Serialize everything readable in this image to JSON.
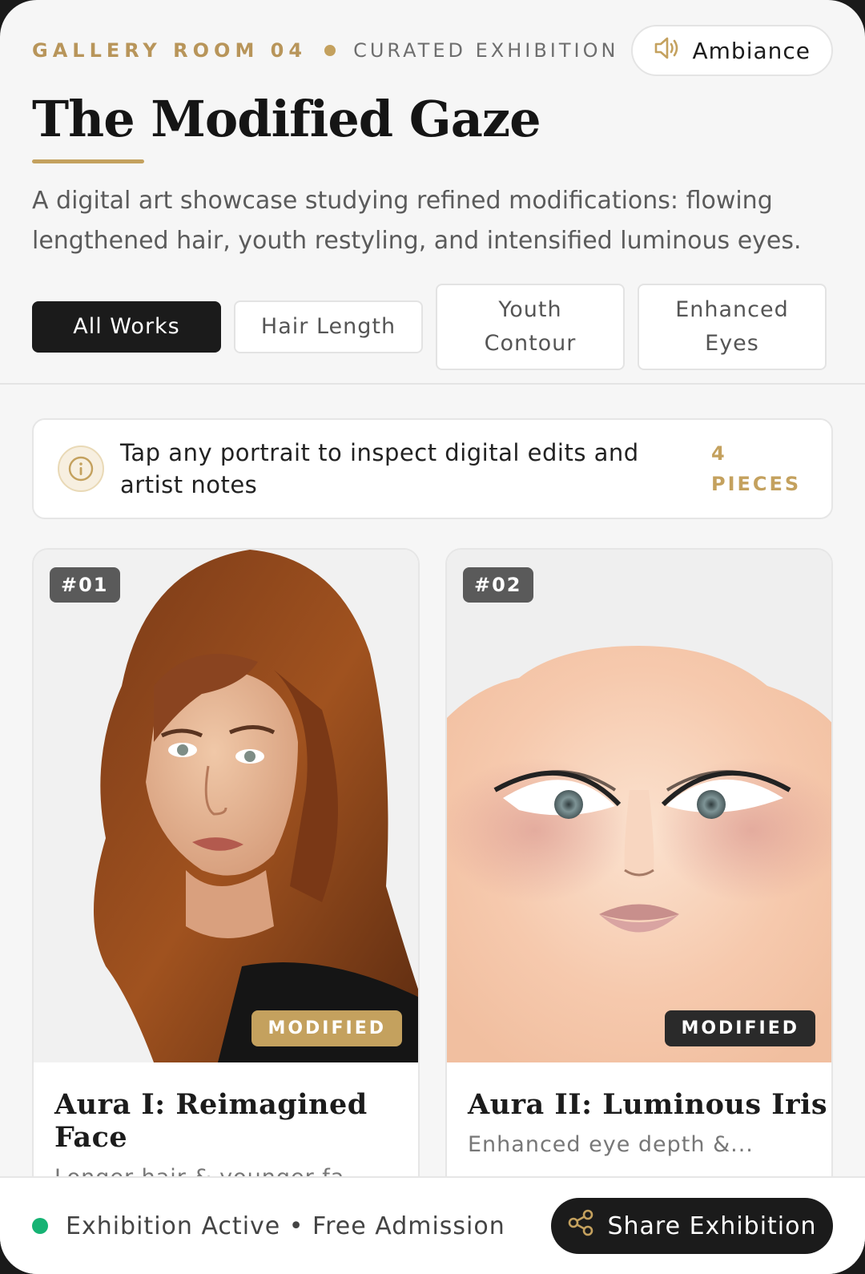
{
  "header": {
    "room": "GALLERY ROOM 04",
    "curated": "CURATED EXHIBITION",
    "ambiance_label": "Ambiance",
    "title": "The Modified Gaze",
    "description": "A digital art showcase studying refined modifications: flowing lengthened hair, youth restyling, and intensified luminous eyes."
  },
  "filters": [
    {
      "label": "All Works",
      "active": true
    },
    {
      "label": "Hair Length",
      "active": false
    },
    {
      "label": "Youth Contour",
      "active": false
    },
    {
      "label": "Enhanced Eyes",
      "active": false
    }
  ],
  "notice": {
    "text": "Tap any portrait to inspect digital edits and artist notes",
    "count": "4",
    "count_label": "PIECES"
  },
  "cards": [
    {
      "number": "#01",
      "badge": "MODIFIED",
      "title": "Aura I: Reimagined Face",
      "subtitle": "Longer hair & younger facial..."
    },
    {
      "number": "#02",
      "badge": "MODIFIED",
      "title": "Aura II: Luminous Iris",
      "subtitle": "Enhanced eye depth &..."
    }
  ],
  "footer": {
    "status": "Exhibition Active • Free Admission",
    "share_label": "Share Exhibition"
  },
  "icons": {
    "speaker": "speaker-icon",
    "info": "info-icon",
    "share": "share-icon"
  },
  "colors": {
    "accent_gold": "#c4a15e",
    "dark": "#1b1b1b",
    "live_green": "#16b374"
  }
}
